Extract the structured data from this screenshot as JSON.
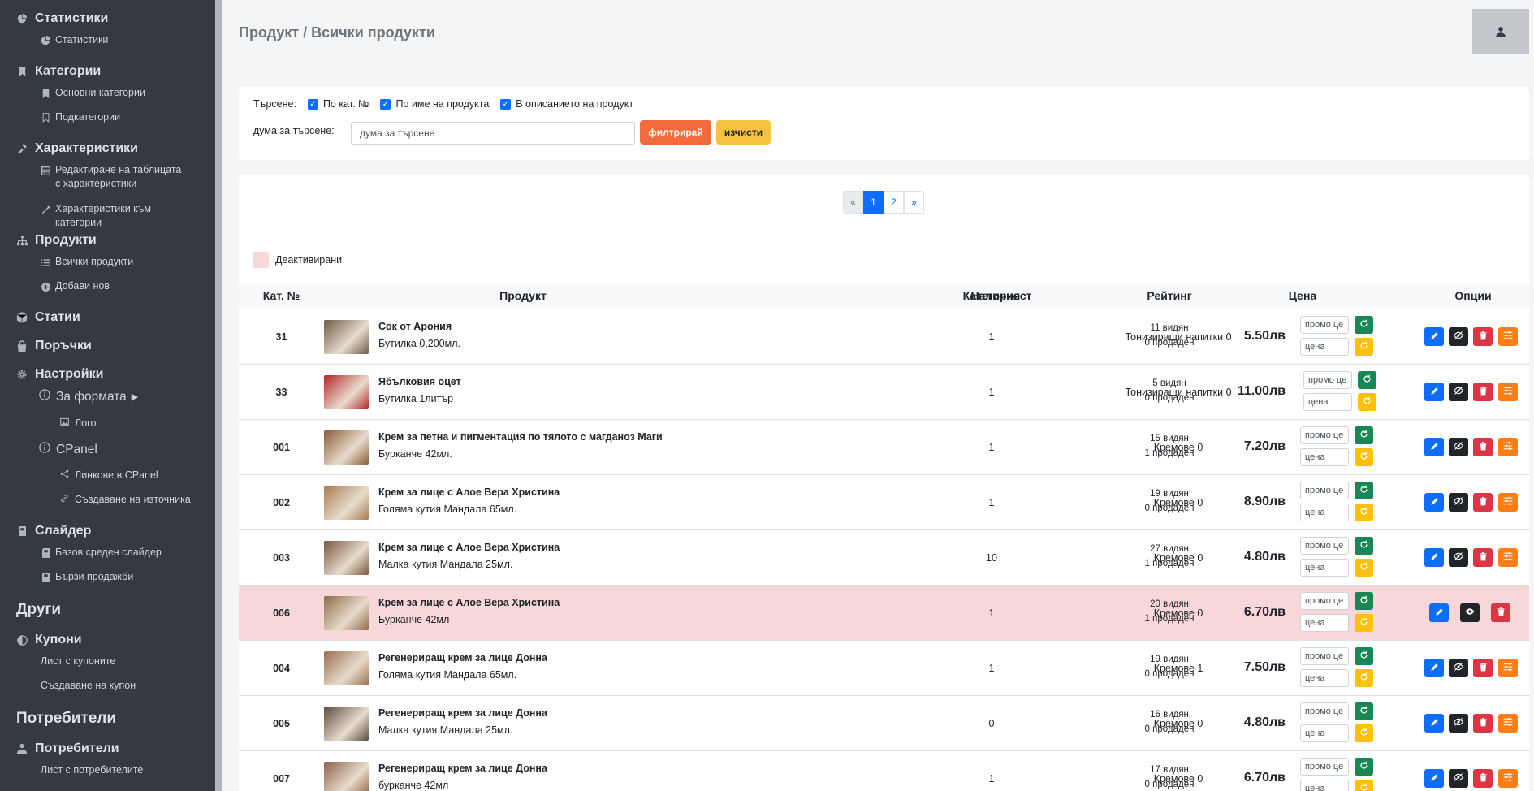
{
  "sidebar": {
    "sections": [
      {
        "label": "Статистики",
        "icon": "chart-pie-icon",
        "items": [
          {
            "label": "Статистики",
            "icon": "chart-pie-icon"
          }
        ]
      },
      {
        "label": "Категории",
        "icon": "bookmark-icon",
        "items": [
          {
            "label": "Основни категории",
            "icon": "bookmark-icon"
          },
          {
            "label": "Подкатегории",
            "icon": "bookmark-outline-icon"
          }
        ]
      },
      {
        "label": "Характеристики",
        "icon": "tools-icon",
        "items": [
          {
            "label": "Редактиране на таблицата с характеристики",
            "icon": "table-icon"
          },
          {
            "label": "Характеристики към категории",
            "icon": "wand-icon"
          }
        ]
      },
      {
        "label": "Продукти",
        "icon": "sitemap-icon",
        "items": [
          {
            "label": "Всички продукти",
            "icon": "list-icon"
          },
          {
            "label": "Добави нов",
            "icon": "plus-circle-icon"
          }
        ]
      },
      {
        "label": "Статии",
        "icon": "cube-icon",
        "items": []
      },
      {
        "label": "Поръчки",
        "icon": "bag-icon",
        "items": []
      },
      {
        "label": "Настройки",
        "icon": "gear-icon",
        "items": []
      }
    ],
    "settings_sub": {
      "form": {
        "label": "За формата",
        "icon": "info-circle-icon",
        "items": [
          {
            "label": "Лого",
            "icon": "image-icon"
          }
        ]
      },
      "cpanel": {
        "label": "CPanel",
        "icon": "info-circle-icon",
        "items": [
          {
            "label": "Линкове в CPanel",
            "icon": "share-icon"
          },
          {
            "label": "Създаване на източника",
            "icon": "link-icon"
          }
        ]
      }
    },
    "slider": {
      "label": "Слайдер",
      "icon": "sd-card-icon",
      "items": [
        {
          "label": "Базов среден слайдер",
          "icon": "sd-card-icon"
        },
        {
          "label": "Бързи продажби",
          "icon": "sd-card-icon"
        }
      ]
    },
    "other_group": "Други",
    "coupons": {
      "label": "Купони",
      "icon": "half-moon-icon",
      "items": [
        {
          "label": "Лист с купоните"
        },
        {
          "label": "Създаване на купон"
        }
      ]
    },
    "users_group": "Потребители",
    "users": {
      "label": "Потребители",
      "icon": "users-icon",
      "items": [
        {
          "label": "Лист с потребителите"
        }
      ]
    }
  },
  "header": {
    "title": "Продукт / Всички продукти",
    "user_icon": "user-icon"
  },
  "search": {
    "label": "Търсене:",
    "options": [
      "По кат. №",
      "По име на продукта",
      "В описанието на продукт"
    ],
    "term_label": "дума за търсене:",
    "value": "дума за търсене",
    "filter_label": "филтрирай",
    "clear_label": "изчисти"
  },
  "pagination": [
    "«",
    "1",
    "2",
    "»"
  ],
  "legend": "Деактивирани",
  "columns": [
    "Кат. №",
    "Продукт",
    "Наличност",
    "Категория",
    "Рейтинг",
    "Цена",
    "Опции"
  ],
  "price_inputs": {
    "promo": "промо це",
    "price": "цена"
  },
  "rows": [
    {
      "id": "31",
      "name": "Сок от Арония",
      "desc": "Бутилка 0,200мл.",
      "stock": "1",
      "category": "Тонизиращи напитки 0",
      "views": "11 видян",
      "sold": "0 продаден",
      "price": "5.50лв",
      "deactivated": false,
      "thumb": "#6b5a4a"
    },
    {
      "id": "33",
      "name": "Ябълковия оцет",
      "desc": "Бутилка 1литър",
      "stock": "1",
      "category": "Тонизиращи напитки 0",
      "views": "5 видян",
      "sold": "0 продаден",
      "price": "11.00лв",
      "deactivated": false,
      "thumb": "#b3262b"
    },
    {
      "id": "001",
      "name": "Крем за петна и пигментация по тялото с магданоз Маги",
      "desc": "Бурканче 42мл.",
      "stock": "1",
      "category": "Кремове 0",
      "views": "15 видян",
      "sold": "1 продаден",
      "price": "7.20лв",
      "deactivated": false,
      "thumb": "#8c5a3c"
    },
    {
      "id": "002",
      "name": "Крем за лице с Алое Вера Христина",
      "desc": "Голяма кутия Мандала 65мл.",
      "stock": "1",
      "category": "Кремове 0",
      "views": "19 видян",
      "sold": "0 продаден",
      "price": "8.90лв",
      "deactivated": false,
      "thumb": "#a67c52"
    },
    {
      "id": "003",
      "name": "Крем за лице с Алое Вера Христина",
      "desc": "Малка кутия Мандала 25мл.",
      "stock": "10",
      "category": "Кремове 0",
      "views": "27 видян",
      "sold": "1 продаден",
      "price": "4.80лв",
      "deactivated": false,
      "thumb": "#7a5540"
    },
    {
      "id": "006",
      "name": "Крем за лице с Алое Вера Христина",
      "desc": "Бурканче 42мл",
      "stock": "1",
      "category": "Кремове 0",
      "views": "20 видян",
      "sold": "1 продаден",
      "price": "6.70лв",
      "deactivated": true,
      "thumb": "#8c6a48"
    },
    {
      "id": "004",
      "name": "Регенериращ крем за лице Донна",
      "desc": "Голяма кутия Мандала 65мл.",
      "stock": "1",
      "category": "Кремове 1",
      "views": "19 видян",
      "sold": "0 продаден",
      "price": "7.50лв",
      "deactivated": false,
      "thumb": "#9a7050"
    },
    {
      "id": "005",
      "name": "Регенериращ крем за лице Донна",
      "desc": "Малка кутия Мандала 25мл.",
      "stock": "0",
      "category": "Кремове 0",
      "views": "16 видян",
      "sold": "0 продаден",
      "price": "4.80лв",
      "deactivated": false,
      "thumb": "#5a4a40"
    },
    {
      "id": "007",
      "name": "Регенериращ крем за лице Донна",
      "desc": "бурканче 42мл",
      "stock": "1",
      "category": "Кремове 0",
      "views": "17 видян",
      "sold": "0 продаден",
      "price": "6.70лв",
      "deactivated": false,
      "thumb": "#8c6048"
    }
  ],
  "colors": {
    "edit": "#0d6efd",
    "view": "#212529",
    "delete": "#dc3545",
    "props": "#fd7e14",
    "save": "#198754",
    "reset": "#ffc107",
    "filter": "#f26b3a",
    "clear": "#f7c242",
    "deactivated": "#f8d7da"
  }
}
